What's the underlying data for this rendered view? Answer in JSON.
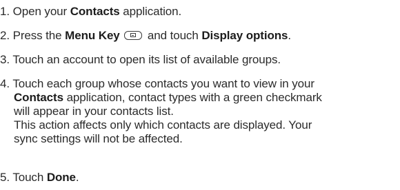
{
  "steps": [
    {
      "number": "1.",
      "text_before": "Open your",
      "ui_term": "Contacts",
      "text_after": "application."
    },
    {
      "number": "2.",
      "text_before": "Press the",
      "ui_term": "Menu Key",
      "icon": "menu-key-icon",
      "text_middle": "and touch",
      "ui_term_2": "Display options",
      "text_after": "."
    },
    {
      "number": "3.",
      "text": "Touch an account to open its list of available groups."
    },
    {
      "number": "4.",
      "line1": "Touch each group whose contacts you want to view in your",
      "ui_term": "Contacts",
      "line2_after": "application, contact types with a green checkmark",
      "line3": "will appear in your contacts list.",
      "line4": "This action affects only which contacts are displayed. Your",
      "line5": "sync settings will not be affected."
    },
    {
      "number": "5.",
      "text_before": "Touch",
      "ui_term": "Done",
      "text_after": "."
    }
  ]
}
